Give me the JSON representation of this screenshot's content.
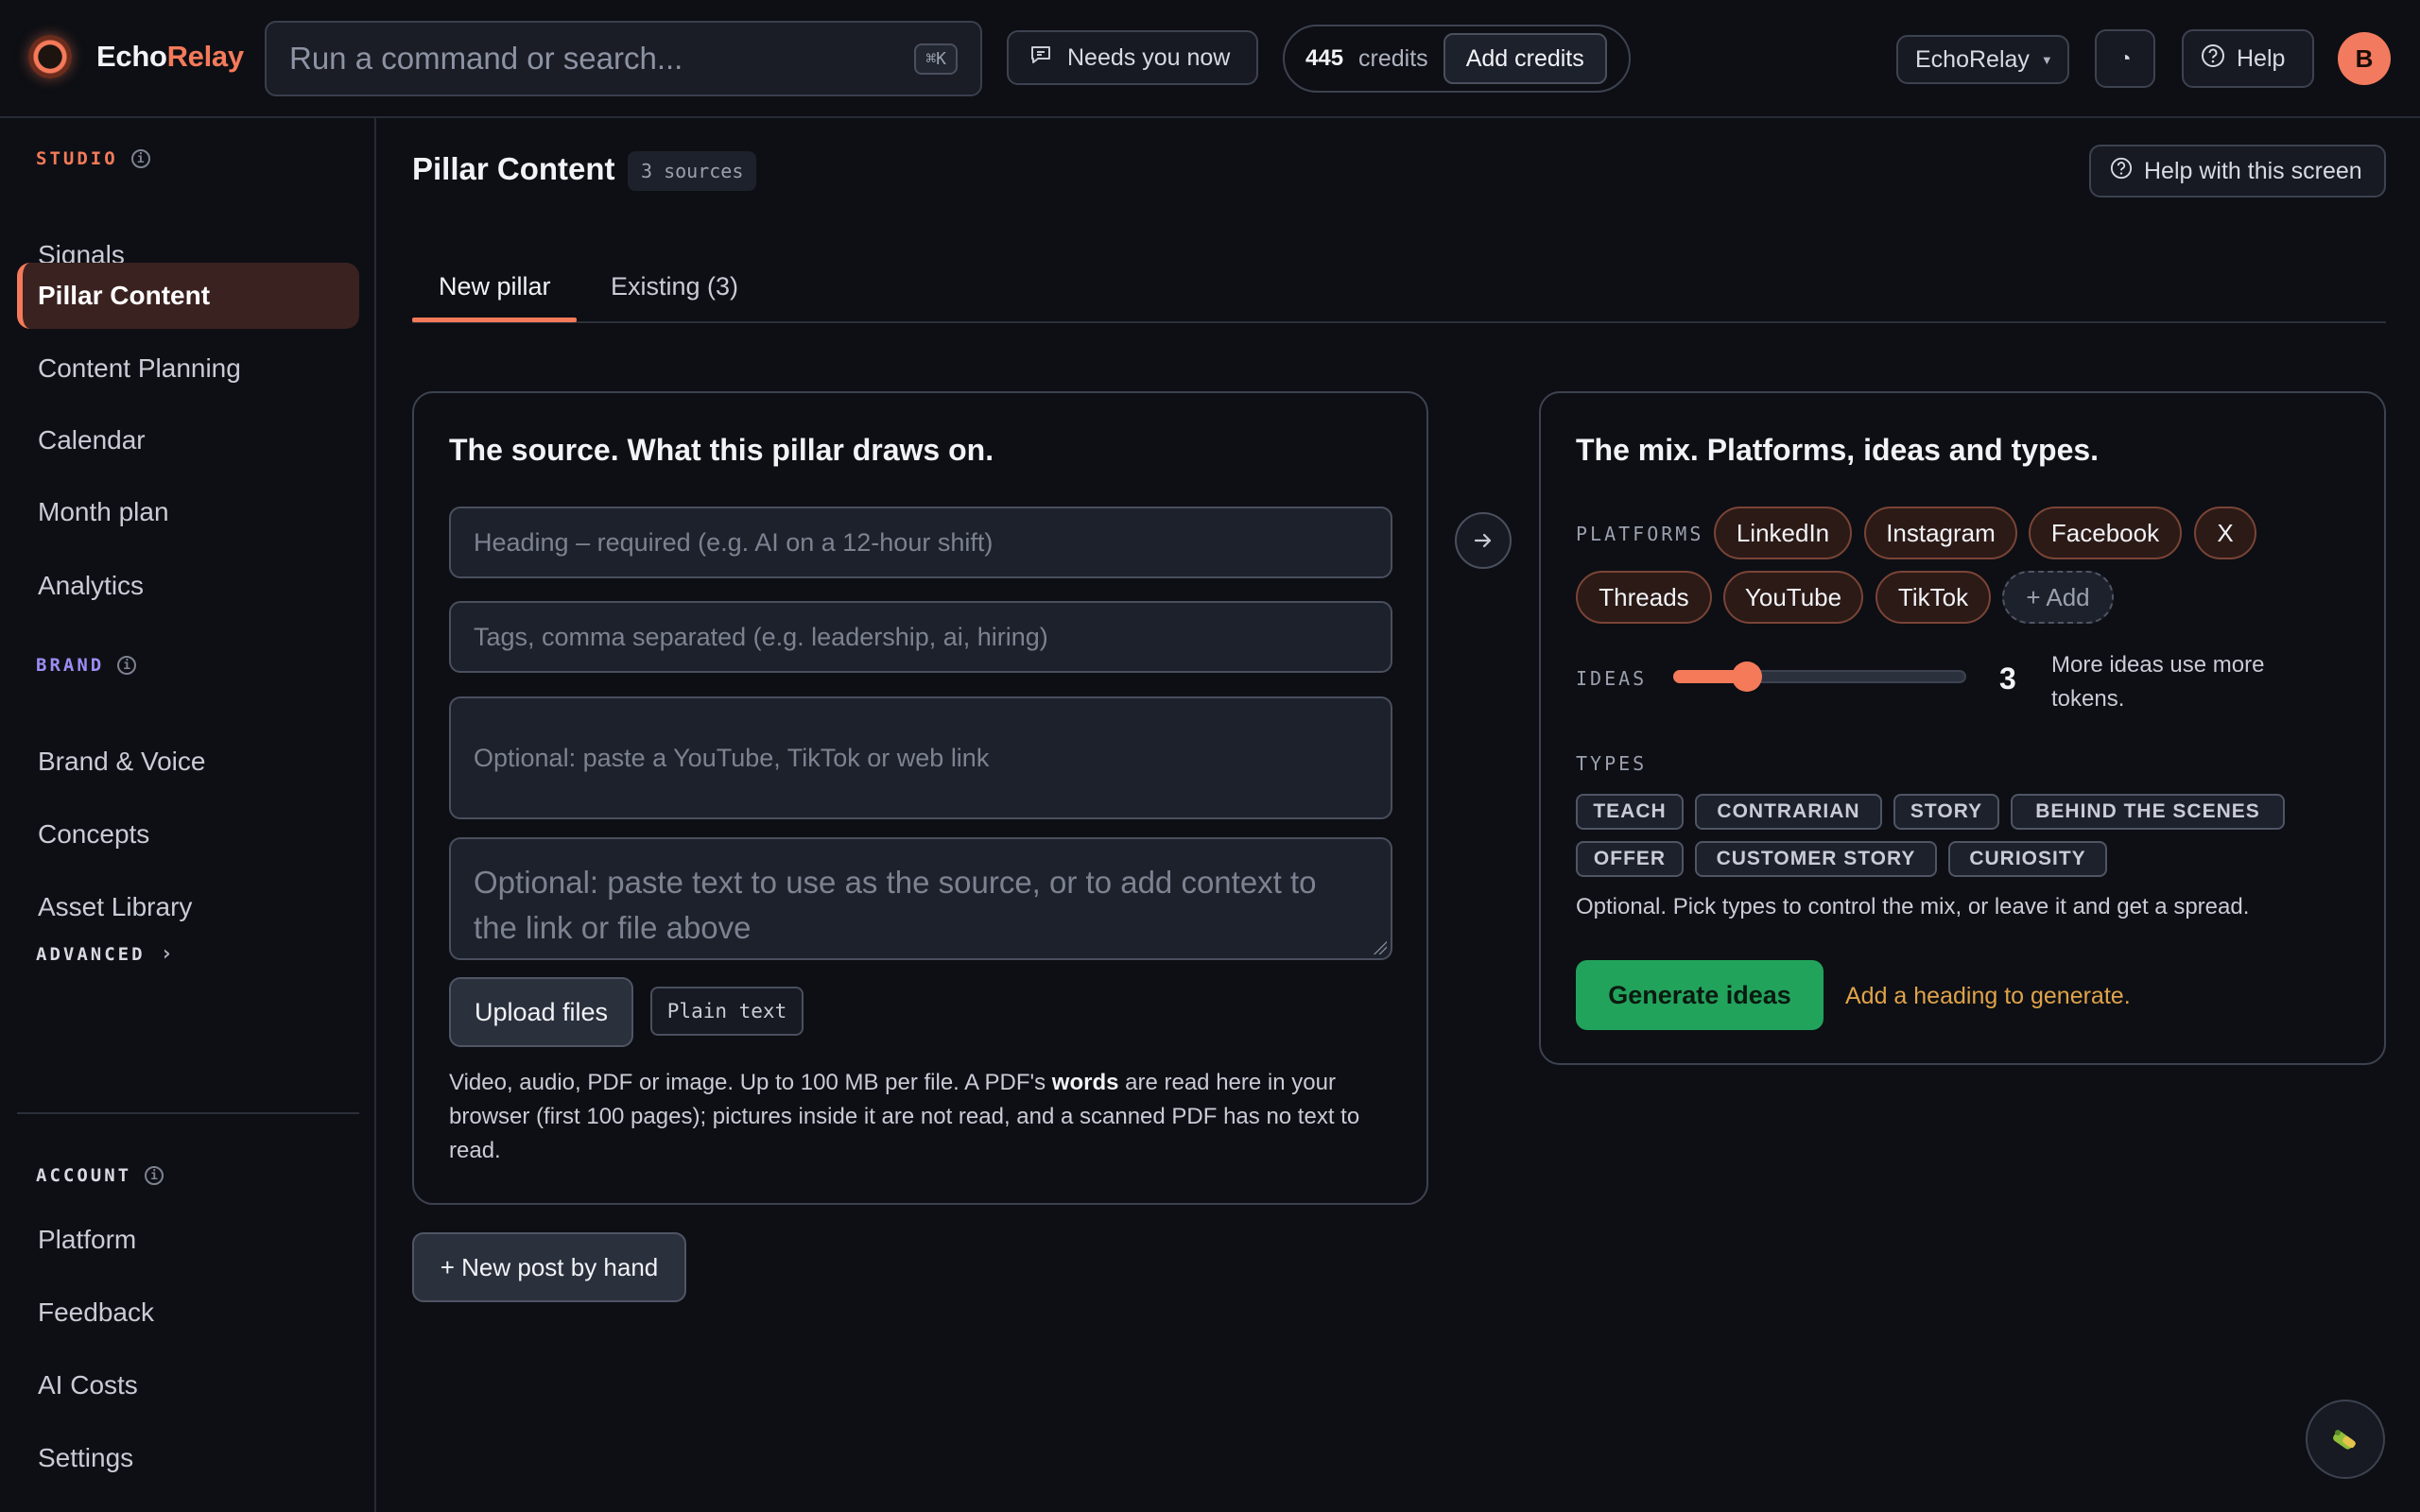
{
  "app": {
    "name_part1": "Echo",
    "name_part2": "Relay"
  },
  "topbar": {
    "search_placeholder": "Run a command or search...",
    "search_shortcut": "⌘K",
    "needs_you": "Needs you now",
    "credits_count": "445",
    "credits_label": "credits",
    "add_credits": "Add credits",
    "workspace": "EchoRelay",
    "help": "Help",
    "avatar_initial": "B"
  },
  "sidebar": {
    "studio_label": "STUDIO",
    "studio_items": [
      "Signals",
      "Pillar Content",
      "Content Planning",
      "Calendar",
      "Month plan",
      "Analytics"
    ],
    "active_item": "Pillar Content",
    "brand_label": "BRAND",
    "brand_items": [
      "Brand & Voice",
      "Concepts",
      "Asset Library"
    ],
    "advanced_label": "ADVANCED",
    "account_label": "ACCOUNT",
    "account_items": [
      "Platform",
      "Feedback",
      "AI Costs",
      "Settings"
    ]
  },
  "page": {
    "title": "Pillar Content",
    "sources_badge": "3 sources",
    "help_screen": "Help with this screen",
    "tabs": [
      "New pillar",
      "Existing (3)"
    ],
    "active_tab": "New pillar"
  },
  "source_card": {
    "title": "The source. What this pillar draws on.",
    "heading_placeholder": "Heading – required (e.g. AI on a 12-hour shift)",
    "tags_placeholder": "Tags, comma separated (e.g. leadership, ai, hiring)",
    "link_placeholder": "Optional: paste a YouTube, TikTok or web link",
    "text_placeholder": "Optional: paste text to use as the source, or to add context to the link or file above",
    "upload_button": "Upload files",
    "plain_text_button": "Plain text",
    "help_part1": "Video, audio, PDF or image. Up to 100 MB per file. A PDF's ",
    "help_bold": "words",
    "help_part2": " are read here in your browser (first 100 pages); pictures inside it are not read, and a scanned PDF has no text to read."
  },
  "new_post_button": "+ New post by hand",
  "mix_card": {
    "title": "The mix. Platforms, ideas and types.",
    "platforms_label": "PLATFORMS",
    "platforms": [
      "LinkedIn",
      "Instagram",
      "Facebook",
      "X",
      "Threads",
      "YouTube",
      "TikTok"
    ],
    "add_platform": "+ Add",
    "ideas_label": "IDEAS",
    "ideas_value": "3",
    "ideas_fraction": 0.25,
    "ideas_note": "More ideas use more tokens.",
    "types_label": "TYPES",
    "types": [
      "TEACH",
      "CONTRARIAN",
      "STORY",
      "BEHIND THE SCENES",
      "OFFER",
      "CUSTOMER STORY",
      "CURIOSITY"
    ],
    "types_note": "Optional. Pick types to control the mix, or leave it and get a spread.",
    "generate_button": "Generate ideas",
    "generate_hint": "Add a heading to generate."
  },
  "colors": {
    "accent": "#f47a5a",
    "brand_label": "#9d8df5",
    "generate": "#22a35c",
    "hint": "#e0a34a"
  }
}
